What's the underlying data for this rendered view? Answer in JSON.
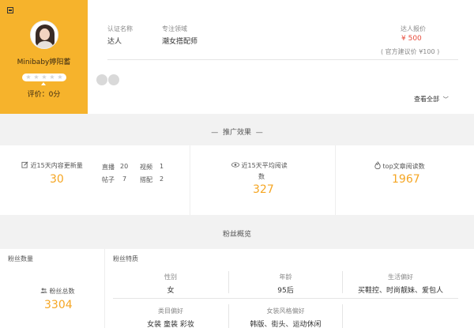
{
  "profile": {
    "name": "Minibaby婷阳蓄",
    "rating": "评价：0分",
    "stars": [
      "★",
      "★",
      "★",
      "★",
      "★"
    ]
  },
  "info": {
    "cert_label": "认证名称",
    "cert_value": "达人",
    "field_label": "专注领域",
    "field_value": "潮女搭配师",
    "price_label": "达人报价",
    "price_value": "¥ 500",
    "suggest": "( 官方建议价 ¥100 )",
    "view_all": "查看全部"
  },
  "promotion": {
    "title": "推广效果",
    "col1": {
      "label": "近15天内容更新量",
      "total": "30",
      "items": [
        {
          "label": "直播",
          "value": "20"
        },
        {
          "label": "视频",
          "value": "1"
        },
        {
          "label": "帖子",
          "value": "7"
        },
        {
          "label": "搭配",
          "value": "2"
        }
      ]
    },
    "col2": {
      "label_line1": "近15天平均阅读",
      "label_line2": "数",
      "value": "327"
    },
    "col3": {
      "label": "top文章阅读数",
      "value": "1967"
    }
  },
  "fans": {
    "title": "粉丝概览",
    "count_label": "粉丝数量",
    "total_label": "粉丝总数",
    "total_value": "3304",
    "traits_label": "粉丝特质",
    "traits": [
      {
        "label": "性别",
        "value": "女"
      },
      {
        "label": "年龄",
        "value": "95后"
      },
      {
        "label": "生活偏好",
        "value": "买鞋控、时尚靓妹、爱包人"
      },
      {
        "label": "类目偏好",
        "value": "女装 童装 彩妆"
      },
      {
        "label": "女装风格偏好",
        "value": "韩版、街头、运动休闲"
      }
    ]
  },
  "colors": {
    "accent": "#f6b32c",
    "number": "#f5a623",
    "price": "#e74c3c"
  }
}
